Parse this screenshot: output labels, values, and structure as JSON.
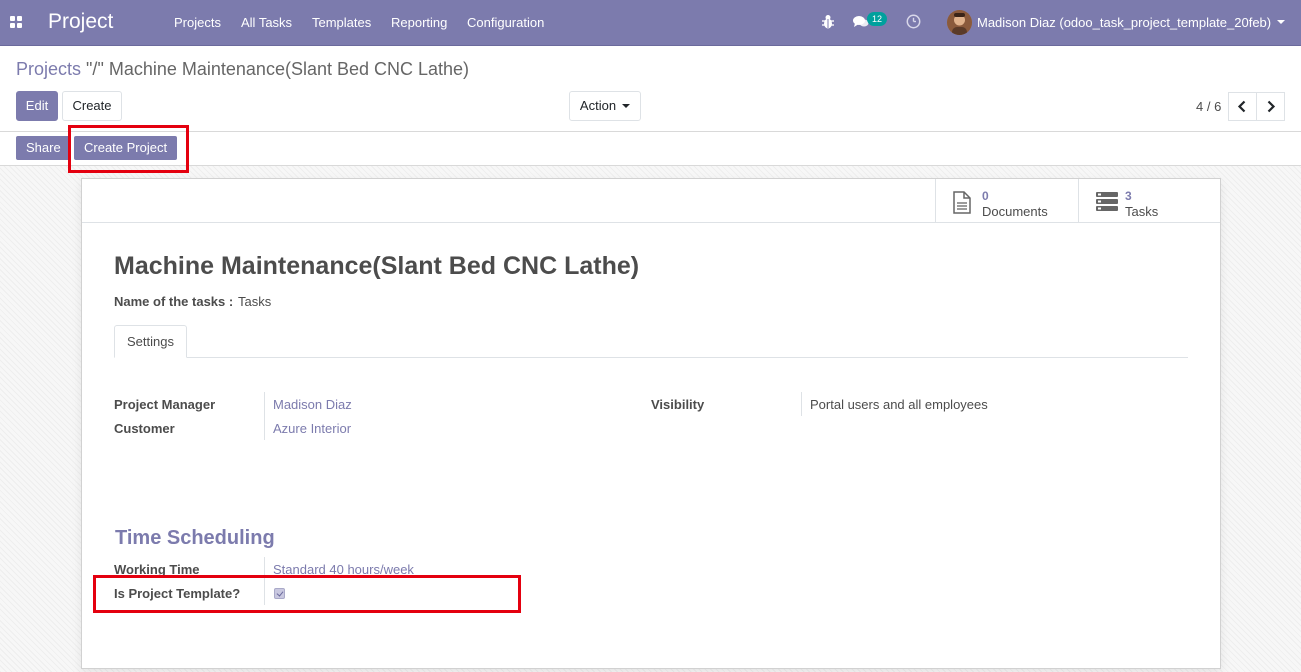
{
  "navbar": {
    "app_title": "Project",
    "menu": [
      "Projects",
      "All Tasks",
      "Templates",
      "Reporting",
      "Configuration"
    ],
    "messages_count": "12",
    "user_name": "Madison Diaz (odoo_task_project_template_20feb)",
    "icons": [
      "apps-icon",
      "bug-icon",
      "chat-icon",
      "clock-icon",
      "caret-down-icon"
    ],
    "color": "#7c7bad"
  },
  "breadcrumb": {
    "parent": "Projects",
    "separator": "\"/\"",
    "current": "Machine Maintenance(Slant Bed CNC Lathe)"
  },
  "buttons": {
    "edit": "Edit",
    "create": "Create",
    "action": "Action"
  },
  "pager": {
    "value": "4 / 6",
    "icons": [
      "chevron-left-icon",
      "chevron-right-icon"
    ]
  },
  "statusbar": {
    "share": "Share",
    "create_project": "Create Project"
  },
  "stat_buttons": [
    {
      "value": "0",
      "label": "Documents",
      "icon": "document-icon"
    },
    {
      "value": "3",
      "label": "Tasks",
      "icon": "tasks-icon"
    }
  ],
  "record": {
    "title": "Machine Maintenance(Slant Bed CNC Lathe)",
    "tasks_name_label": "Name of the tasks :",
    "tasks_name_value": "Tasks"
  },
  "tabs": [
    "Settings"
  ],
  "fields": {
    "project_manager_label": "Project Manager",
    "project_manager_value": "Madison Diaz",
    "customer_label": "Customer",
    "customer_value": "Azure Interior",
    "visibility_label": "Visibility",
    "visibility_value": "Portal users and all employees"
  },
  "time_scheduling": {
    "title": "Time Scheduling",
    "working_time_label": "Working Time",
    "working_time_value": "Standard 40 hours/week",
    "is_template_label": "Is Project Template?",
    "is_template_checked": true
  },
  "colors": {
    "primary": "#7c7bad",
    "highlight": "#e4000f",
    "badge": "#00a09d"
  }
}
